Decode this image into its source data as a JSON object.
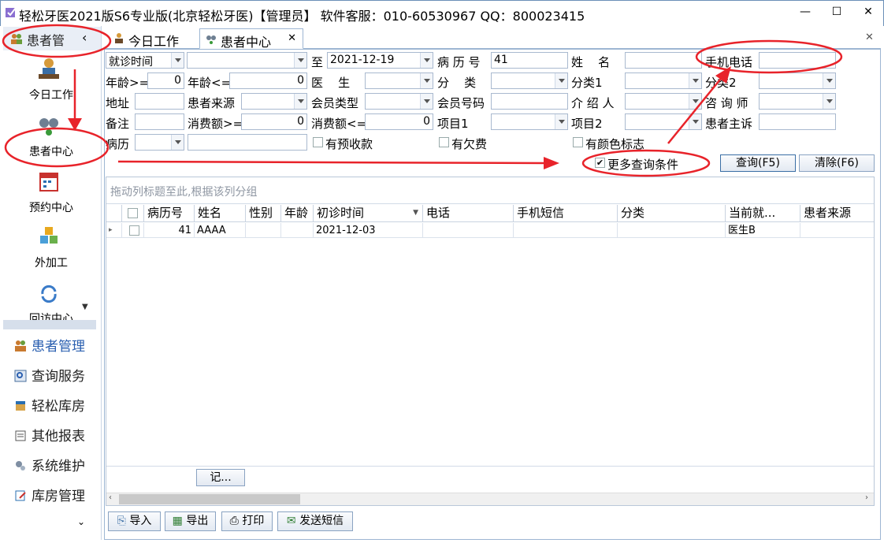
{
  "window": {
    "title": "轻松牙医2021版S6专业版(北京轻松牙医)【管理员】   软件客服：010-60530967 QQ：800023415"
  },
  "sidebar": {
    "header": "患者管",
    "nav": [
      {
        "label": "今日工作"
      },
      {
        "label": "患者中心"
      },
      {
        "label": "预约中心"
      },
      {
        "label": "外加工"
      },
      {
        "label": "回访中心"
      }
    ],
    "modules": [
      {
        "label": "患者管理"
      },
      {
        "label": "查询服务"
      },
      {
        "label": "轻松库房"
      },
      {
        "label": "其他报表"
      },
      {
        "label": "系统维护"
      },
      {
        "label": "库房管理"
      }
    ]
  },
  "tabs": [
    {
      "label": "今日工作"
    },
    {
      "label": "患者中心"
    }
  ],
  "filters": {
    "date_type": "就诊时间",
    "to_label": "至",
    "date_to": "2021-12-19",
    "record_no_label": "病 历 号",
    "record_no": "41",
    "name_label": "姓    名",
    "mobile_label": "手机电话",
    "age_min_label": "年龄>=",
    "age_min": "0",
    "age_max_label": "年龄<=",
    "age_max": "0",
    "doctor_label": "医    生",
    "category_label": "分    类",
    "cat1_label": "分类1",
    "cat2_label": "分类2",
    "address_label": "地址",
    "source_label": "患者来源",
    "member_type_label": "会员类型",
    "member_no_label": "会员号码",
    "referrer_label": "介 绍 人",
    "consultant_label": "咨 询 师",
    "note_label": "备注",
    "spend_min_label": "消费额>=",
    "spend_min": "0",
    "spend_max_label": "消费额<=",
    "spend_max": "0",
    "item1_label": "项目1",
    "item2_label": "项目2",
    "complaint_label": "患者主诉",
    "history_label": "病历",
    "prepay_label": "有预收款",
    "debt_label": "有欠费",
    "color_label": "有颜色标志",
    "more_label": "更多查询条件",
    "query_btn": "查询(F5)",
    "clear_btn": "清除(F6)"
  },
  "grid": {
    "group_hint": "拖动列标题至此,根据该列分组",
    "columns": [
      "病历号",
      "姓名",
      "性别",
      "年龄",
      "初诊时间",
      "电话",
      "手机短信",
      "分类",
      "当前就...",
      "患者来源"
    ],
    "rows": [
      {
        "record_no": "41",
        "name": "AAAA",
        "gender": "",
        "age": "",
        "first_visit": "2021-12-03",
        "phone": "",
        "sms": "",
        "category": "",
        "doctor": "医生B",
        "source": ""
      }
    ],
    "footer_btn": "记..."
  },
  "bottom": {
    "import": "导入",
    "export": "导出",
    "print": "打印",
    "sms": "发送短信"
  },
  "colors": {
    "annotation": "#e8232a",
    "accent": "#3a6ea5"
  }
}
